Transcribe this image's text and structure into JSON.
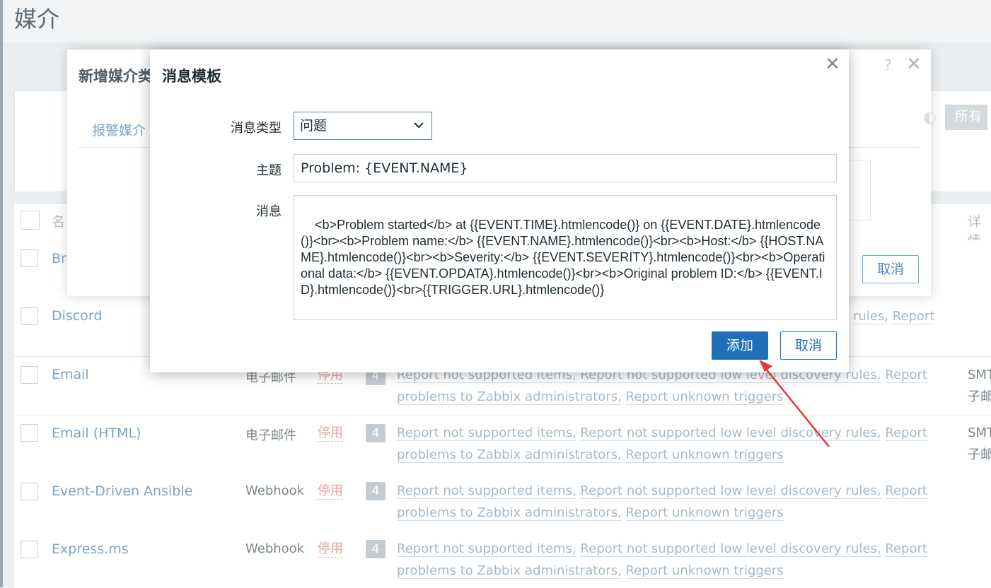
{
  "page": {
    "title": "媒介"
  },
  "table": {
    "header_name": "名",
    "header_detail": "详情",
    "rows": [
      {
        "name": "Br",
        "type": "",
        "status": "",
        "count": "",
        "actions": [],
        "actions_line2": [],
        "detail": ""
      },
      {
        "name": "Discord",
        "type": "",
        "status": "",
        "count": "",
        "actions": [
          "rules,",
          "Report"
        ],
        "actions_line2": [],
        "detail": ""
      },
      {
        "name": "Email",
        "type": "电子邮件",
        "status": "停用",
        "count": "4",
        "actions": [
          "Report not supported items,",
          "Report not supported low level discovery rules,",
          "Report"
        ],
        "actions_line2": [
          "problems to Zabbix administrators,",
          "Report unknown triggers"
        ],
        "detail": "SMT",
        "detail2": "子邮"
      },
      {
        "name": "Email (HTML)",
        "type": "电子邮件",
        "status": "停用",
        "count": "4",
        "actions": [
          "Report not supported items,",
          "Report not supported low level discovery rules,",
          "Report"
        ],
        "actions_line2": [
          "problems to Zabbix administrators,",
          "Report unknown triggers"
        ],
        "detail": "SMT",
        "detail2": "子邮"
      },
      {
        "name": "Event-Driven Ansible",
        "type": "Webhook",
        "status": "停用",
        "count": "4",
        "actions": [
          "Report not supported items,",
          "Report not supported low level discovery rules,",
          "Report"
        ],
        "actions_line2": [
          "problems to Zabbix administrators,",
          "Report unknown triggers"
        ],
        "detail": "",
        "detail2": ""
      },
      {
        "name": "Express.ms",
        "type": "Webhook",
        "status": "停用",
        "count": "4",
        "actions": [
          "Report not supported items,",
          "Report not supported low level discovery rules,",
          "Report"
        ],
        "actions_line2": [
          "problems to Zabbix administrators,",
          "Report unknown triggers"
        ],
        "detail": "",
        "detail2": ""
      }
    ]
  },
  "back_dialog": {
    "title": "新增媒介类",
    "help": "?",
    "close": "✕",
    "tab": "报警媒介",
    "all_button": "所有",
    "cancel": "取消"
  },
  "dialog": {
    "title": "消息模板",
    "close": "✕",
    "message_type_label": "消息类型",
    "message_type_value": "问题",
    "subject_label": "主题",
    "subject_value": "Problem: {EVENT.NAME}",
    "message_label": "消息",
    "message_value": "<b>Problem started</b> at {{EVENT.TIME}.htmlencode()} on {{EVENT.DATE}.htmlencode()}<br><b>Problem name:</b> {{EVENT.NAME}.htmlencode()}<br><b>Host:</b> {{HOST.NAME}.htmlencode()}<br><b>Severity:</b> {{EVENT.SEVERITY}.htmlencode()}<br><b>Operational data:</b> {{EVENT.OPDATA}.htmlencode()}<br><b>Original problem ID:</b> {{EVENT.ID}.htmlencode()}<br>{{TRIGGER.URL}.htmlencode()}",
    "add_button": "添加",
    "cancel_button": "取消"
  },
  "colors": {
    "primary": "#1f70b9",
    "link": "#7aa4c5",
    "status_disabled": "#e8a1a1",
    "arrow": "#e03a3a"
  },
  "icons": {
    "close": "close-icon",
    "dropdown": "chevron-down-icon",
    "help": "help-icon",
    "resize": "resize-handle-icon"
  }
}
